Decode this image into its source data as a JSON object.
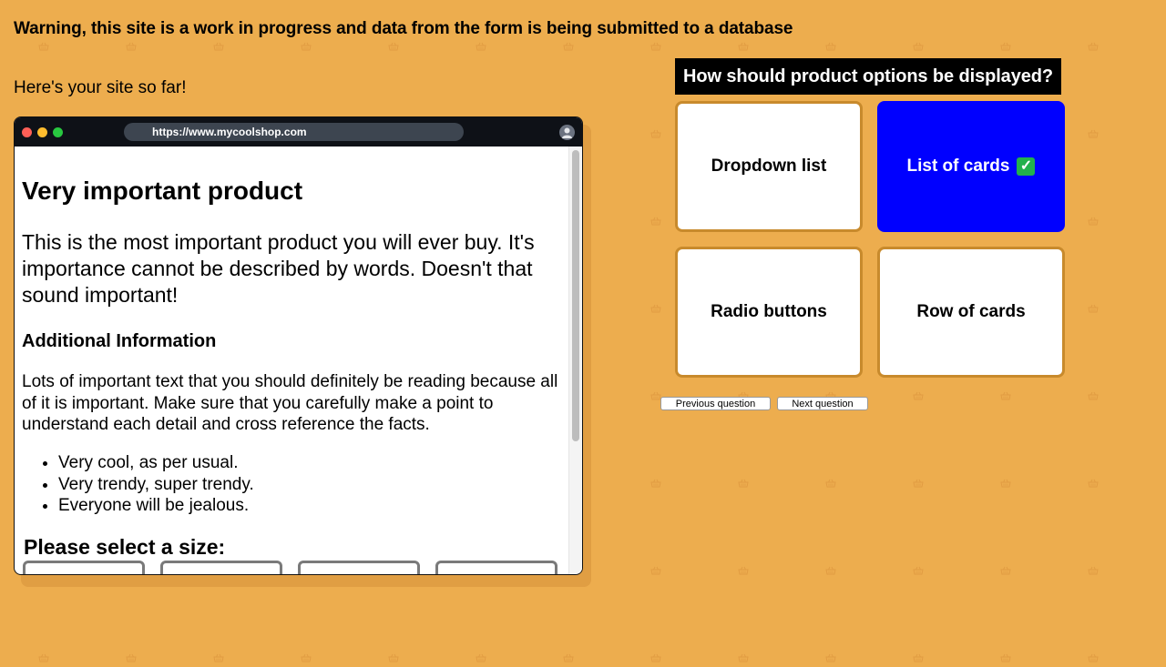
{
  "page": {
    "warning": "Warning, this site is a work in progress and data from the form is being submitted to a database",
    "intro": "Here's your site so far!"
  },
  "browser": {
    "url": "https://www.mycoolshop.com",
    "icons": [
      "close-dot",
      "minimize-dot",
      "maximize-dot",
      "user-avatar-icon"
    ]
  },
  "site": {
    "title": "Very important product",
    "description": "This is the most important product you will ever buy. It's importance cannot be described by words. Doesn't that sound important!",
    "subheading": "Additional Information",
    "body": "Lots of important text that you should definitely be reading because all of it is important. Make sure that you carefully make a point to understand each detail and cross reference the facts.",
    "features": [
      "Very cool, as per usual.",
      "Very trendy, super trendy.",
      "Everyone will be jealous."
    ],
    "size_label": "Please select a size:"
  },
  "quiz": {
    "question": "How should product options be displayed?",
    "options": [
      {
        "label": "Dropdown list",
        "selected": false
      },
      {
        "label": "List of cards",
        "selected": true
      },
      {
        "label": "Radio buttons",
        "selected": false
      },
      {
        "label": "Row of cards",
        "selected": false
      }
    ],
    "selected_mark": "✅",
    "prev_label": "Previous question",
    "next_label": "Next question"
  },
  "colors": {
    "background": "#EDAD4E",
    "selected": "#0000FF",
    "question_bg": "#000000"
  }
}
